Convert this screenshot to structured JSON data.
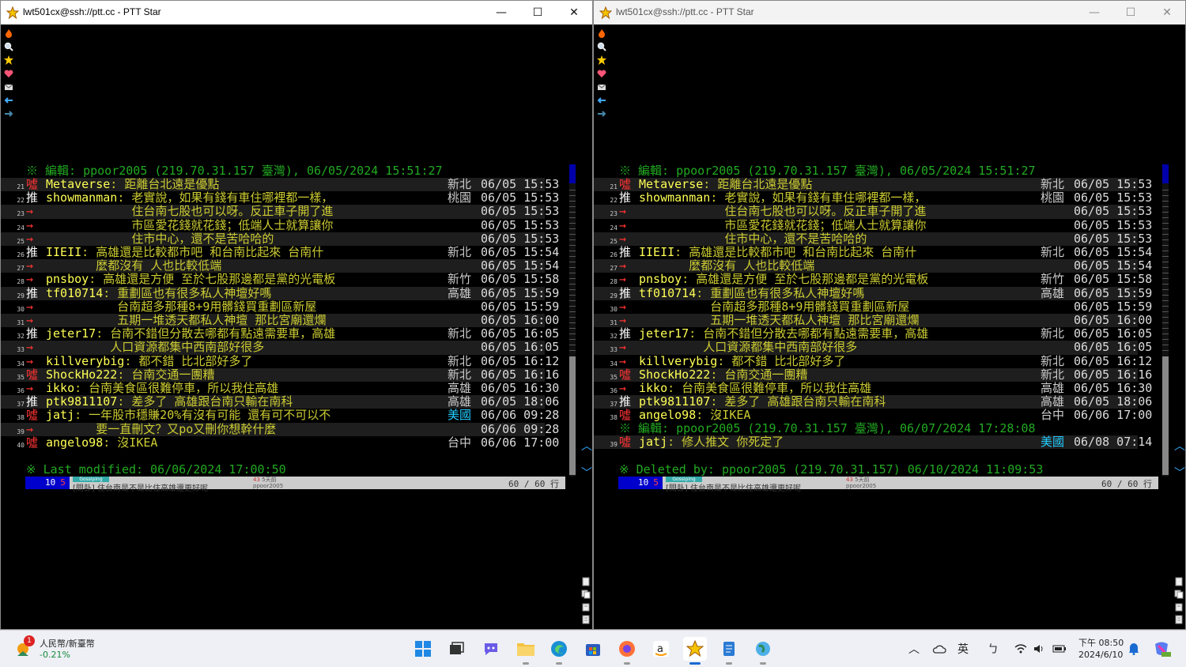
{
  "windows": {
    "left": {
      "title": "lwt501cx@ssh://ptt.cc - PTT Star"
    },
    "right": {
      "title": "lwt501cx@ssh://ptt.cc - PTT Star"
    }
  },
  "titlebar": {
    "minimize": "—",
    "maximize": "☐",
    "close": "✕"
  },
  "left_term": {
    "edit_line": "※ 編輯: ppoor2005 (219.70.31.157 臺灣), 06/05/2024 15:51:27",
    "rows": [
      {
        "n": "21",
        "tag": "噓",
        "type": "boo",
        "user": "Metaverse",
        "msg": ": 距離台北遠是優點",
        "loc": "新北",
        "time": "06/05 15:53"
      },
      {
        "n": "22",
        "tag": "推",
        "type": "push",
        "user": "showmanman",
        "msg": ": 老實說，如果有錢有車住哪裡都一樣，",
        "loc": "桃園",
        "time": "06/05 15:53"
      },
      {
        "n": "23",
        "tag": "→",
        "type": "arrow",
        "user": "",
        "msg": "            住台南七股也可以呀。反正車子開了進",
        "loc": "",
        "time": "06/05 15:53"
      },
      {
        "n": "24",
        "tag": "→",
        "type": "arrow",
        "user": "",
        "msg": "            市區愛花錢就花錢；低端人士就算讓你",
        "loc": "",
        "time": "06/05 15:53"
      },
      {
        "n": "25",
        "tag": "→",
        "type": "arrow",
        "user": "",
        "msg": "            住市中心，還不是苦哈哈的",
        "loc": "",
        "time": "06/05 15:53"
      },
      {
        "n": "26",
        "tag": "推",
        "type": "push",
        "user": "IIEII",
        "msg": ": 高雄還是比較都市吧 和台南比起來 台南什",
        "loc": "新北",
        "time": "06/05 15:54"
      },
      {
        "n": "27",
        "tag": "→",
        "type": "arrow",
        "user": "",
        "msg": "       麼都沒有 人也比較低端",
        "loc": "",
        "time": "06/05 15:54"
      },
      {
        "n": "28",
        "tag": "→",
        "type": "arrow",
        "user": "pnsboy",
        "msg": ": 高雄還是方便 至於七股那邊都是黨的光電板",
        "loc": "新竹",
        "time": "06/05 15:58"
      },
      {
        "n": "29",
        "tag": "推",
        "type": "push",
        "user": "tf010714",
        "msg": ": 重劃區也有很多私人神壇好嗎",
        "loc": "高雄",
        "time": "06/05 15:59"
      },
      {
        "n": "30",
        "tag": "→",
        "type": "arrow",
        "user": "",
        "msg": "          台南超多那種8+9用髒錢買重劃區新屋",
        "loc": "",
        "time": "06/05 15:59"
      },
      {
        "n": "31",
        "tag": "→",
        "type": "arrow",
        "user": "",
        "msg": "          五期一堆透天都私人神壇 那比宮廟還爛",
        "loc": "",
        "time": "06/05 16:00"
      },
      {
        "n": "32",
        "tag": "推",
        "type": "push",
        "user": "jeter17",
        "msg": ": 台南不錯但分散去哪都有點遠需要車，高雄",
        "loc": "新北",
        "time": "06/05 16:05"
      },
      {
        "n": "33",
        "tag": "→",
        "type": "arrow",
        "user": "",
        "msg": "         人口資源都集中西南部好很多",
        "loc": "",
        "time": "06/05 16:05"
      },
      {
        "n": "34",
        "tag": "→",
        "type": "arrow",
        "user": "killverybig",
        "msg": ": 都不錯 比北部好多了",
        "loc": "新北",
        "time": "06/05 16:12"
      },
      {
        "n": "35",
        "tag": "噓",
        "type": "boo",
        "user": "ShockHo222",
        "msg": ": 台南交通一團糟",
        "loc": "新北",
        "time": "06/05 16:16"
      },
      {
        "n": "36",
        "tag": "→",
        "type": "arrow",
        "user": "ikko",
        "msg": ": 台南美食區很難停車，所以我住高雄",
        "loc": "高雄",
        "time": "06/05 16:30"
      },
      {
        "n": "37",
        "tag": "推",
        "type": "push",
        "user": "ptk9811107",
        "msg": ": 差多了 高雄跟台南只輸在南科",
        "loc": "高雄",
        "time": "06/05 18:06"
      },
      {
        "n": "38",
        "tag": "噓",
        "type": "boo",
        "user": "jatj",
        "msg": ": 一年股市穩賺20%有沒有可能 還有可不可以不",
        "loc": "美國",
        "time": "06/06 09:28"
      },
      {
        "n": "39",
        "tag": "→",
        "type": "arrow",
        "user": "",
        "msg": "       要一直刪文？又po又刪你想幹什麼",
        "loc": "",
        "time": "06/06 09:28"
      },
      {
        "n": "40",
        "tag": "噓",
        "type": "boo",
        "user": "angelo98",
        "msg": ": 沒IKEA",
        "loc": "台中",
        "time": "06/06 17:00"
      }
    ],
    "footer_line": "※ Last modified: 06/06/2024 17:00:50"
  },
  "right_term": {
    "edit_line": "※ 編輯: ppoor2005 (219.70.31.157 臺灣), 06/05/2024 15:51:27",
    "rows": [
      {
        "n": "21",
        "tag": "噓",
        "type": "boo",
        "user": "Metaverse",
        "msg": ": 距離台北遠是優點",
        "loc": "新北",
        "time": "06/05 15:53"
      },
      {
        "n": "22",
        "tag": "推",
        "type": "push",
        "user": "showmanman",
        "msg": ": 老實說，如果有錢有車住哪裡都一樣，",
        "loc": "桃園",
        "time": "06/05 15:53"
      },
      {
        "n": "23",
        "tag": "→",
        "type": "arrow",
        "user": "",
        "msg": "            住台南七股也可以呀。反正車子開了進",
        "loc": "",
        "time": "06/05 15:53"
      },
      {
        "n": "24",
        "tag": "→",
        "type": "arrow",
        "user": "",
        "msg": "            市區愛花錢就花錢；低端人士就算讓你",
        "loc": "",
        "time": "06/05 15:53"
      },
      {
        "n": "25",
        "tag": "→",
        "type": "arrow",
        "user": "",
        "msg": "            住市中心，還不是苦哈哈的",
        "loc": "",
        "time": "06/05 15:53"
      },
      {
        "n": "26",
        "tag": "推",
        "type": "push",
        "user": "IIEII",
        "msg": ": 高雄還是比較都市吧 和台南比起來 台南什",
        "loc": "新北",
        "time": "06/05 15:54"
      },
      {
        "n": "27",
        "tag": "→",
        "type": "arrow",
        "user": "",
        "msg": "       麼都沒有 人也比較低端",
        "loc": "",
        "time": "06/05 15:54"
      },
      {
        "n": "28",
        "tag": "→",
        "type": "arrow",
        "user": "pnsboy",
        "msg": ": 高雄還是方便 至於七股那邊都是黨的光電板",
        "loc": "新竹",
        "time": "06/05 15:58"
      },
      {
        "n": "29",
        "tag": "推",
        "type": "push",
        "user": "tf010714",
        "msg": ": 重劃區也有很多私人神壇好嗎",
        "loc": "高雄",
        "time": "06/05 15:59"
      },
      {
        "n": "30",
        "tag": "→",
        "type": "arrow",
        "user": "",
        "msg": "          台南超多那種8+9用髒錢買重劃區新屋",
        "loc": "",
        "time": "06/05 15:59"
      },
      {
        "n": "31",
        "tag": "→",
        "type": "arrow",
        "user": "",
        "msg": "          五期一堆透天都私人神壇 那比宮廟還爛",
        "loc": "",
        "time": "06/05 16:00"
      },
      {
        "n": "32",
        "tag": "推",
        "type": "push",
        "user": "jeter17",
        "msg": ": 台南不錯但分散去哪都有點遠需要車，高雄",
        "loc": "新北",
        "time": "06/05 16:05"
      },
      {
        "n": "33",
        "tag": "→",
        "type": "arrow",
        "user": "",
        "msg": "         人口資源都集中西南部好很多",
        "loc": "",
        "time": "06/05 16:05"
      },
      {
        "n": "34",
        "tag": "→",
        "type": "arrow",
        "user": "killverybig",
        "msg": ": 都不錯 比北部好多了",
        "loc": "新北",
        "time": "06/05 16:12"
      },
      {
        "n": "35",
        "tag": "噓",
        "type": "boo",
        "user": "ShockHo222",
        "msg": ": 台南交通一團糟",
        "loc": "新北",
        "time": "06/05 16:16"
      },
      {
        "n": "36",
        "tag": "→",
        "type": "arrow",
        "user": "ikko",
        "msg": ": 台南美食區很難停車，所以我住高雄",
        "loc": "高雄",
        "time": "06/05 16:30"
      },
      {
        "n": "37",
        "tag": "推",
        "type": "push",
        "user": "ptk9811107",
        "msg": ": 差多了 高雄跟台南只輸在南科",
        "loc": "高雄",
        "time": "06/05 18:06"
      },
      {
        "n": "38",
        "tag": "噓",
        "type": "boo",
        "user": "angelo98",
        "msg": ": 沒IKEA",
        "loc": "台中",
        "time": "06/06 17:00"
      }
    ],
    "edit_line2": "※ 編輯: ppoor2005 (219.70.31.157 臺灣), 06/07/2024 17:28:08",
    "row39": {
      "n": "39",
      "tag": "噓",
      "type": "boo",
      "user": "jatj",
      "msg": ": 修人推文 你死定了",
      "loc": "美國",
      "time": "06/08 07:14"
    },
    "footer_line": "※ Deleted by: ppoor2005 (219.70.31.157) 06/10/2024 11:09:53"
  },
  "status": {
    "num": "10",
    "num2": "5",
    "board_tag": "Gossiping",
    "title": "[問卦] 住台南是不是比住高雄還更好呢",
    "author_top": "43",
    "author_top2": "5天前",
    "author": "ppoor2005",
    "lines": "60 / 60 行"
  },
  "taskbar": {
    "widget_badge": "1",
    "widget_title": "人民幣/新臺幣",
    "widget_value": "-0.21%",
    "ime": "英",
    "clock_time": "下午 08:50",
    "clock_date": "2024/6/10"
  },
  "colors": {
    "push": "#ffffff",
    "boo": "#ff3333",
    "uid": "#ffff55",
    "msg": "#cccc33",
    "sys": "#22aa22",
    "accent": "#1a6ad2"
  }
}
